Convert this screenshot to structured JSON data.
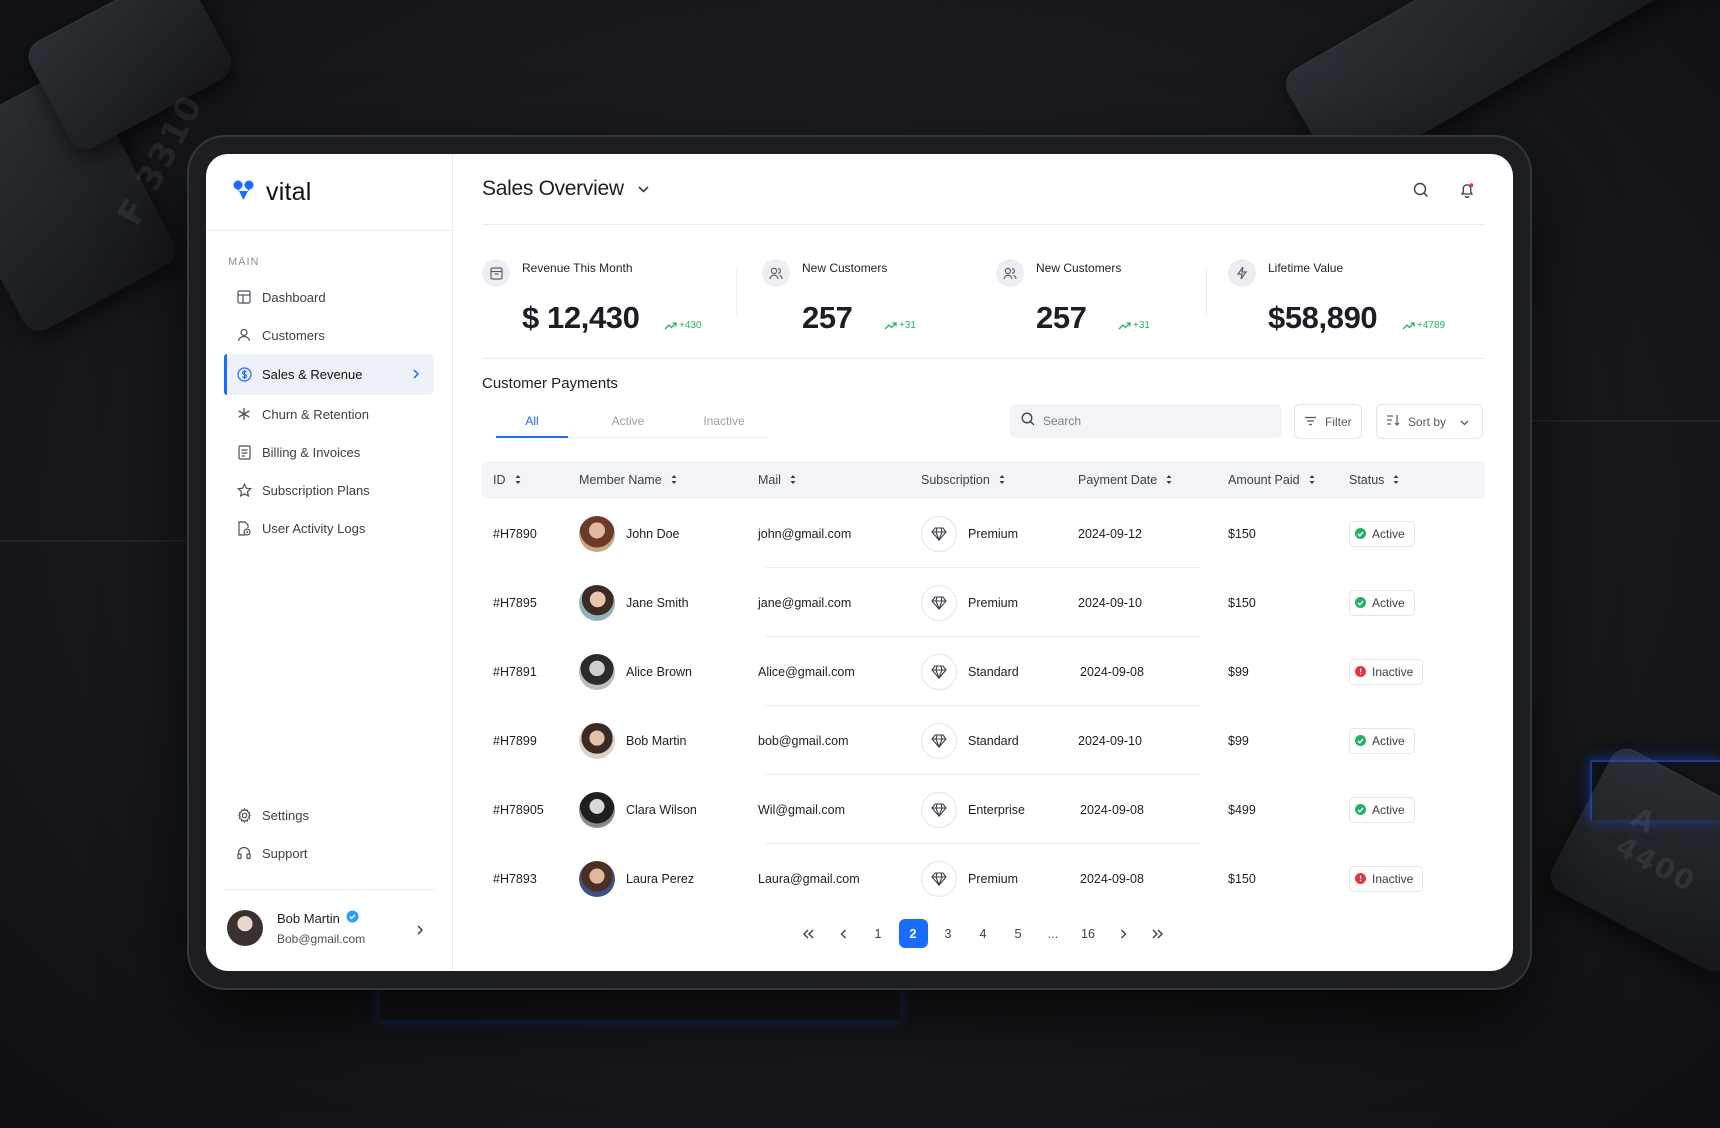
{
  "brand": {
    "name": "vital",
    "color": "#1a6bff"
  },
  "sidebar": {
    "section_label": "MAIN",
    "items": [
      {
        "label": "Dashboard",
        "icon": "grid-icon"
      },
      {
        "label": "Customers",
        "icon": "users-icon"
      },
      {
        "label": "Sales & Revenue",
        "icon": "dollar-circle-icon",
        "active": true
      },
      {
        "label": "Churn & Retention",
        "icon": "asterisk-icon"
      },
      {
        "label": "Billing & Invoices",
        "icon": "invoice-icon"
      },
      {
        "label": "Subscription Plans",
        "icon": "star-icon"
      },
      {
        "label": "User Activity Logs",
        "icon": "document-clock-icon"
      }
    ],
    "bottom_items": [
      {
        "label": "Settings",
        "icon": "gear-icon"
      },
      {
        "label": "Support",
        "icon": "headset-icon"
      }
    ],
    "user": {
      "name": "Bob Martin",
      "email": "Bob@gmail.com"
    }
  },
  "header": {
    "title": "Sales Overview"
  },
  "stats": [
    {
      "label": "Revenue This Month",
      "value": "$ 12,430",
      "delta": "+430",
      "icon": "archive-icon"
    },
    {
      "label": "New Customers",
      "value": "257",
      "delta": "+31",
      "icon": "users-icon"
    },
    {
      "label": "New Customers",
      "value": "257",
      "delta": "+31",
      "icon": "users-icon"
    },
    {
      "label": "Lifetime Value",
      "value": "$58,890",
      "delta": "+4789",
      "icon": "bolt-icon"
    }
  ],
  "payments": {
    "title": "Customer Payments",
    "tabs": [
      "All",
      "Active",
      "Inactive"
    ],
    "active_tab": "All",
    "search_placeholder": "Search",
    "filter_label": "Filter",
    "sort_label": "Sort by",
    "columns": [
      "ID",
      "Member Name",
      "Mail",
      "Subscription",
      "Payment Date",
      "Amount Paid",
      "Status"
    ],
    "rows": [
      {
        "id": "#H7890",
        "name": "John Doe",
        "mail": "john@gmail.com",
        "subscription": "Premium",
        "date": "2024-09-12",
        "amount": "$150",
        "status": "Active"
      },
      {
        "id": "#H7895",
        "name": "Jane Smith",
        "mail": "jane@gmail.com",
        "subscription": "Premium",
        "date": "2024-09-10",
        "amount": "$150",
        "status": "Active"
      },
      {
        "id": "#H7891",
        "name": "Alice Brown",
        "mail": "Alice@gmail.com",
        "subscription": "Standard",
        "date": "2024-09-08",
        "amount": "$99",
        "status": "Inactive"
      },
      {
        "id": "#H7899",
        "name": "Bob Martin",
        "mail": "bob@gmail.com",
        "subscription": "Standard",
        "date": "2024-09-10",
        "amount": "$99",
        "status": "Active"
      },
      {
        "id": "#H78905",
        "name": "Clara Wilson",
        "mail": "Wil@gmail.com",
        "subscription": "Enterprise",
        "date": "2024-09-08",
        "amount": "$499",
        "status": "Active"
      },
      {
        "id": "#H7893",
        "name": "Laura Perez",
        "mail": "Laura@gmail.com",
        "subscription": "Premium",
        "date": "2024-09-08",
        "amount": "$150",
        "status": "Inactive"
      }
    ]
  },
  "pagination": {
    "pages": [
      "1",
      "2",
      "3",
      "4",
      "5",
      "...",
      "16"
    ],
    "current": "2"
  },
  "colors": {
    "accent": "#1a6bff",
    "positive": "#22b265",
    "negative": "#e5363d"
  }
}
